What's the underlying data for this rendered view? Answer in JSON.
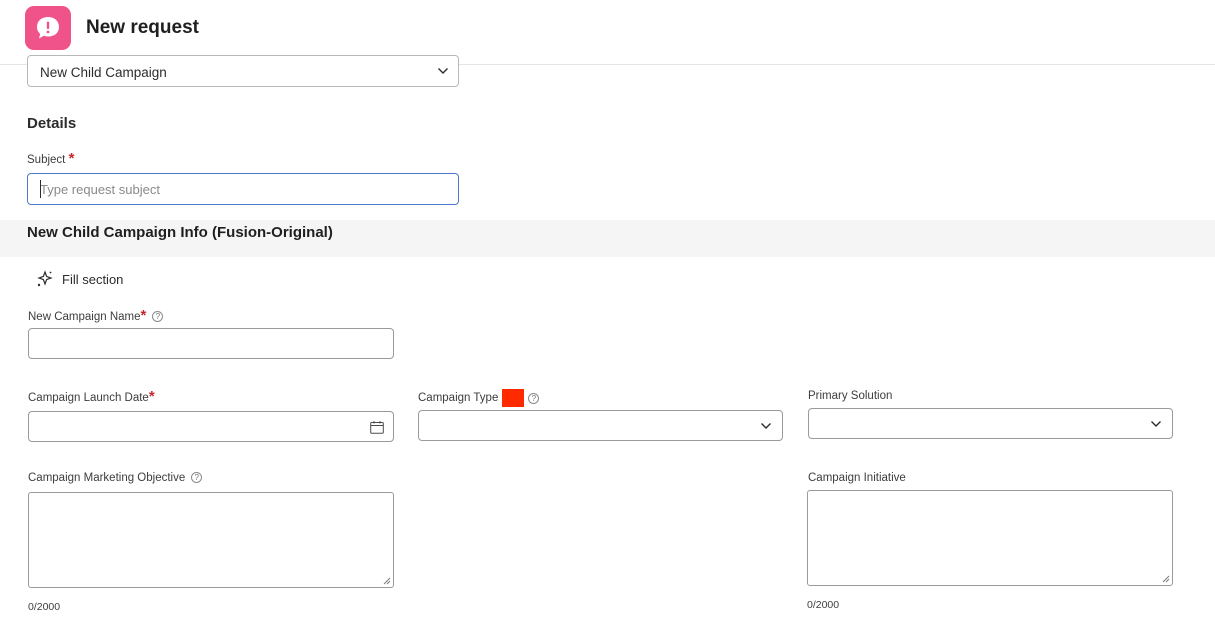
{
  "header": {
    "title": "New request",
    "logo_icon": "speech-bubble-alert-icon",
    "logo_color": "#f0528a"
  },
  "request_type": {
    "value": "New Child Campaign"
  },
  "details": {
    "heading": "Details",
    "subject_label": "Subject",
    "required_mark": "*",
    "subject_placeholder": "Type request subject",
    "subject_value": ""
  },
  "section": {
    "title": "New Child Campaign Info (Fusion-Original)",
    "fill_label": "Fill section",
    "fill_icon": "sparkle-icon"
  },
  "fields": {
    "campaign_name": {
      "label": "New Campaign Name",
      "required": "*",
      "help": "?"
    },
    "launch_date": {
      "label": "Campaign Launch Date",
      "required": "*",
      "icon": "calendar-icon"
    },
    "campaign_type": {
      "label": "Campaign Type",
      "swatch_color": "#ff2a00",
      "help": "?"
    },
    "primary_solution": {
      "label": "Primary Solution"
    },
    "marketing_objective": {
      "label": "Campaign Marketing Objective",
      "help": "?",
      "counter": "0/2000"
    },
    "initiative": {
      "label": "Campaign Initiative",
      "counter": "0/2000"
    }
  },
  "colors": {
    "required": "#c9252c",
    "focus_border": "#4a7ac9"
  }
}
